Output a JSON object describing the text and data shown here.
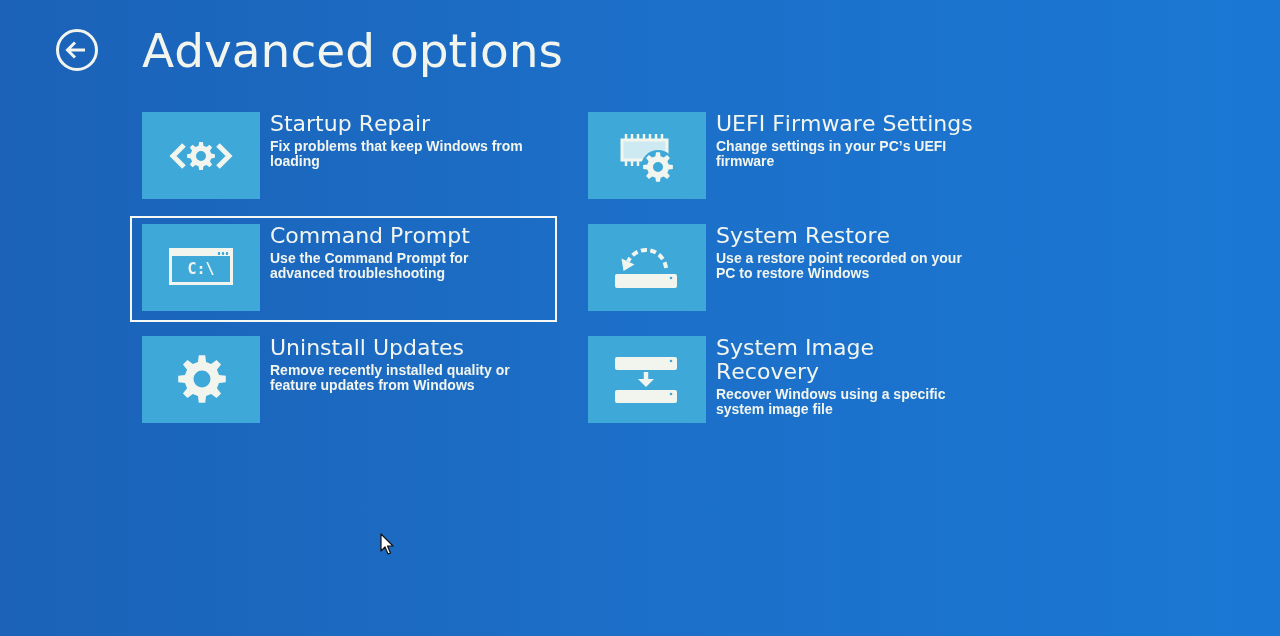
{
  "header": {
    "title": "Advanced options"
  },
  "options": [
    {
      "title": "Startup Repair",
      "description": "Fix problems that keep Windows from loading",
      "selected": false
    },
    {
      "title": "Command Prompt",
      "description": "Use the Command Prompt for advanced troubleshooting",
      "selected": true,
      "icon_text": "C:\\"
    },
    {
      "title": "Uninstall Updates",
      "description": "Remove recently installed quality or feature updates from Windows",
      "selected": false
    },
    {
      "title": "UEFI Firmware Settings",
      "description": "Change settings in your PC’s UEFI firmware",
      "selected": false
    },
    {
      "title": "System Restore",
      "description": "Use a restore point recorded on your PC to restore Windows",
      "selected": false
    },
    {
      "title": "System Image Recovery",
      "description": "Recover Windows using a specific system image file",
      "selected": false
    }
  ]
}
